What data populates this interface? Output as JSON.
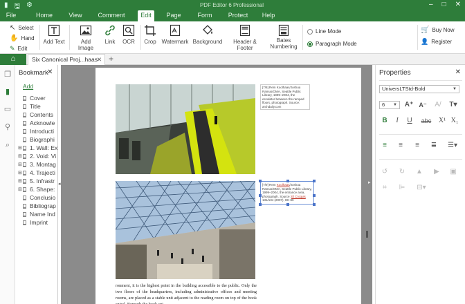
{
  "window": {
    "title": "PDF Editor 6 Professional",
    "controls": [
      "–",
      "□",
      "✕"
    ]
  },
  "menu": {
    "items": [
      "File",
      "Home",
      "View",
      "Comment",
      "Edit",
      "Page",
      "Form",
      "Protect",
      "Help"
    ],
    "active": "Edit"
  },
  "ribbon": {
    "select_label": "Select",
    "hand_label": "Hand",
    "edit_label": "Edit",
    "add_text": "Add Text",
    "add_image": "Add Image",
    "link": "Link",
    "ocr": "OCR",
    "crop": "Crop",
    "watermark": "Watermark",
    "background": "Background",
    "header_footer": "Header & Footer",
    "bates_line1": "Bates",
    "bates_line2": "Numbering",
    "line_mode": "Line Mode",
    "paragraph_mode": "Paragraph Mode",
    "buy_now": "Buy Now",
    "register": "Register"
  },
  "tabs": {
    "doc_tab": "Six Canonical Proj...haas",
    "close": "✕",
    "new_tab": "+"
  },
  "bookmarks": {
    "title": "Bookmark",
    "close": "✕",
    "add": "Add",
    "items": [
      {
        "label": "Cover",
        "expandable": false
      },
      {
        "label": "Title",
        "expandable": false
      },
      {
        "label": "Contents",
        "expandable": false
      },
      {
        "label": "Acknowle",
        "expandable": false
      },
      {
        "label": "Introducti",
        "expandable": false
      },
      {
        "label": "Biographi",
        "expandable": false
      },
      {
        "label": "1. Wall: Ex",
        "expandable": true
      },
      {
        "label": "2. Void: Vi",
        "expandable": true
      },
      {
        "label": "3. Montag",
        "expandable": true
      },
      {
        "label": "4. Trajecti",
        "expandable": true
      },
      {
        "label": "5. Infrastr",
        "expandable": true
      },
      {
        "label": "6. Shape:",
        "expandable": true
      },
      {
        "label": "Conclusio",
        "expandable": false
      },
      {
        "label": "Bibliograp",
        "expandable": false
      },
      {
        "label": "Name Ind",
        "expandable": false
      },
      {
        "label": "Imprint",
        "expandable": false
      }
    ]
  },
  "document": {
    "caption1": "[7/8] Rem Koolhaas/Joshua Ramus/OMA, Seattle Public Library, 1999–2004, the escalator between the ramped floors, photograph. Source: archdaily.com",
    "caption2_a": "[7/9] Rem ",
    "caption2_b": "Koolhaas",
    "caption2_c": "/Joshua Ramus/OMA, Seattle Public Library, 1999–2004, the entrance area, photograph. Source: ",
    "caption2_d": "El Croquis",
    "caption2_e": " 131/134 (2007), 88–89",
    "body": "ronment, it is the highest point in the building accessible to the public. Only the two floors of the headquarters, including administrative offices and meeting rooms, are placed as a stable unit adjacent to the reading room on top of the book spiral. Beneath the book spi-"
  },
  "properties": {
    "title": "Properties",
    "close": "✕",
    "font_name": "UniversLTStd-Bold",
    "font_size": "6"
  },
  "colors": {
    "brand": "#2e7d3a",
    "canvas": "#8b8b8b",
    "selection": "#4a73c9",
    "link_red": "#c0392b"
  }
}
